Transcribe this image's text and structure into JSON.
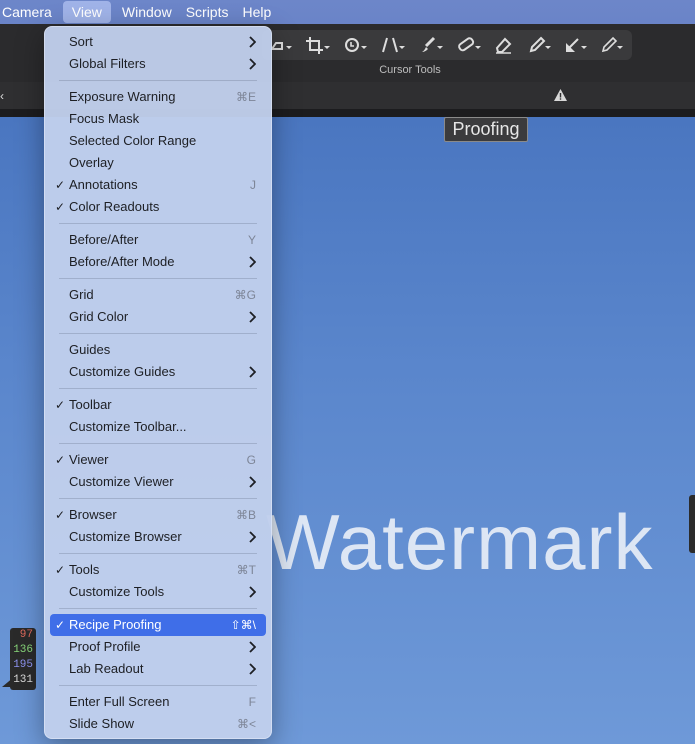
{
  "menubar": {
    "items": [
      "Camera",
      "View",
      "Window",
      "Scripts",
      "Help"
    ],
    "active_index": 1
  },
  "toolbar": {
    "group_label": "Cursor Tools",
    "tools": [
      "rotate-icon",
      "crop-icon",
      "rotate-straighten-icon",
      "keystone-icon",
      "brush-icon",
      "bandage-icon",
      "eraser-icon",
      "picker-icon",
      "arrow-pin-icon",
      "pencil-icon"
    ]
  },
  "viewer": {
    "proofing_badge": "Proofing",
    "watermark": "Watermark",
    "readout": {
      "r": "97",
      "g": "136",
      "b": "195",
      "l": "131",
      "colors": {
        "r": "#e06a5c",
        "g": "#88d67a",
        "b": "#8d93f0",
        "l": "#dcdcdc"
      }
    }
  },
  "view_menu": {
    "items": [
      {
        "type": "item",
        "label": "Sort",
        "submenu": true
      },
      {
        "type": "item",
        "label": "Global Filters",
        "submenu": true
      },
      {
        "type": "sep"
      },
      {
        "type": "item",
        "label": "Exposure Warning",
        "shortcut": "⌘E"
      },
      {
        "type": "item",
        "label": "Focus Mask"
      },
      {
        "type": "item",
        "label": "Selected Color Range"
      },
      {
        "type": "item",
        "label": "Overlay"
      },
      {
        "type": "item",
        "label": "Annotations",
        "checked": true,
        "shortcut": "J"
      },
      {
        "type": "item",
        "label": "Color Readouts",
        "checked": true
      },
      {
        "type": "sep"
      },
      {
        "type": "item",
        "label": "Before/After",
        "shortcut": "Y"
      },
      {
        "type": "item",
        "label": "Before/After Mode",
        "submenu": true
      },
      {
        "type": "sep"
      },
      {
        "type": "item",
        "label": "Grid",
        "shortcut": "⌘G"
      },
      {
        "type": "item",
        "label": "Grid Color",
        "submenu": true
      },
      {
        "type": "sep"
      },
      {
        "type": "item",
        "label": "Guides"
      },
      {
        "type": "item",
        "label": "Customize Guides",
        "submenu": true
      },
      {
        "type": "sep"
      },
      {
        "type": "item",
        "label": "Toolbar",
        "checked": true
      },
      {
        "type": "item",
        "label": "Customize Toolbar..."
      },
      {
        "type": "sep"
      },
      {
        "type": "item",
        "label": "Viewer",
        "checked": true,
        "shortcut": "G"
      },
      {
        "type": "item",
        "label": "Customize Viewer",
        "submenu": true
      },
      {
        "type": "sep"
      },
      {
        "type": "item",
        "label": "Browser",
        "checked": true,
        "shortcut": "⌘B"
      },
      {
        "type": "item",
        "label": "Customize Browser",
        "submenu": true
      },
      {
        "type": "sep"
      },
      {
        "type": "item",
        "label": "Tools",
        "checked": true,
        "shortcut": "⌘T"
      },
      {
        "type": "item",
        "label": "Customize Tools",
        "submenu": true
      },
      {
        "type": "sep"
      },
      {
        "type": "item",
        "label": "Recipe Proofing",
        "checked": true,
        "shortcut": "⇧⌘\\",
        "highlighted": true
      },
      {
        "type": "item",
        "label": "Proof Profile",
        "submenu": true
      },
      {
        "type": "item",
        "label": "Lab Readout",
        "submenu": true
      },
      {
        "type": "sep"
      },
      {
        "type": "item",
        "label": "Enter Full Screen",
        "shortcut": "F"
      },
      {
        "type": "item",
        "label": "Slide Show",
        "shortcut": "⌘<"
      }
    ]
  }
}
